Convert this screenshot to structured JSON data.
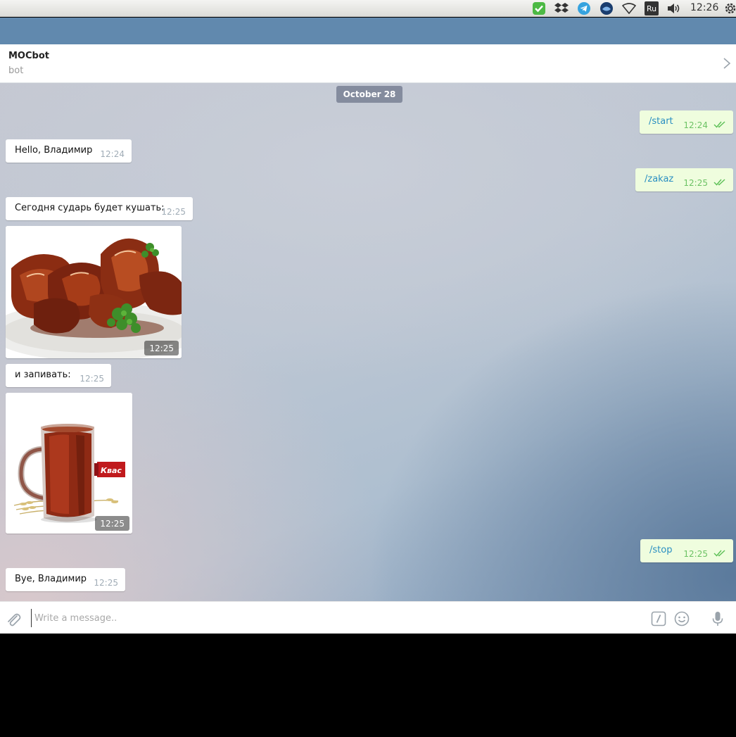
{
  "system_bar": {
    "clock": "12:26",
    "lang_indicator": "Ru",
    "tray_icons": [
      "check-shield-icon",
      "dropbox-icon",
      "telegram-icon",
      "skype-icon",
      "wifi-icon",
      "keyboard-layout-icon",
      "volume-icon",
      "power-gear-icon"
    ]
  },
  "chat_header": {
    "peer_name": "MOCbot",
    "peer_status": "bot"
  },
  "date_separator": "October 28",
  "messages": [
    {
      "direction": "out",
      "text": "/start",
      "time": "12:24",
      "read": true
    },
    {
      "direction": "in",
      "text": "Hello, Владимир",
      "time": "12:24"
    },
    {
      "direction": "out",
      "text": "/zakaz",
      "time": "12:25",
      "read": true
    },
    {
      "direction": "in",
      "text": "Сегодня сударь будет кушать:",
      "time": "12:25"
    },
    {
      "direction": "in",
      "type": "photo",
      "subject": "chicken wings",
      "time": "12:25"
    },
    {
      "direction": "in",
      "text": "и запивать:",
      "time": "12:25"
    },
    {
      "direction": "in",
      "type": "photo",
      "subject": "kvass mug",
      "label": "Квас",
      "time": "12:25"
    },
    {
      "direction": "out",
      "text": "/stop",
      "time": "12:25",
      "read": true
    },
    {
      "direction": "in",
      "text": "Bye, Владимир",
      "time": "12:25"
    }
  ],
  "composer": {
    "placeholder": "Write a message.."
  },
  "colors": {
    "accent_header": "#6189ae",
    "out_bubble": "#effdde",
    "out_text": "#2a8fc2",
    "out_time": "#6cc264",
    "in_time": "#a0acb6"
  }
}
